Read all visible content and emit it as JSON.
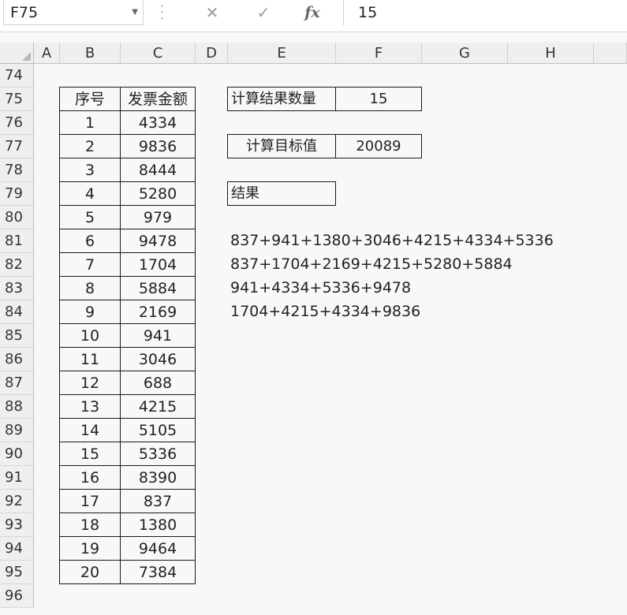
{
  "name_box": "F75",
  "formula_value": "15",
  "columns": [
    "A",
    "B",
    "C",
    "D",
    "E",
    "F",
    "G",
    "H"
  ],
  "rows": [
    "74",
    "75",
    "76",
    "77",
    "78",
    "79",
    "80",
    "81",
    "82",
    "83",
    "84",
    "85",
    "86",
    "87",
    "88",
    "89",
    "90",
    "91",
    "92",
    "93",
    "94",
    "95",
    "96"
  ],
  "table": {
    "headers": [
      "序号",
      "发票金额"
    ],
    "rows": [
      [
        "1",
        "4334"
      ],
      [
        "2",
        "9836"
      ],
      [
        "3",
        "8444"
      ],
      [
        "4",
        "5280"
      ],
      [
        "5",
        "979"
      ],
      [
        "6",
        "9478"
      ],
      [
        "7",
        "1704"
      ],
      [
        "8",
        "5884"
      ],
      [
        "9",
        "2169"
      ],
      [
        "10",
        "941"
      ],
      [
        "11",
        "3046"
      ],
      [
        "12",
        "688"
      ],
      [
        "13",
        "4215"
      ],
      [
        "14",
        "5105"
      ],
      [
        "15",
        "5336"
      ],
      [
        "16",
        "8390"
      ],
      [
        "17",
        "837"
      ],
      [
        "18",
        "1380"
      ],
      [
        "19",
        "9464"
      ],
      [
        "20",
        "7384"
      ]
    ]
  },
  "params": {
    "count_label": "计算结果数量",
    "count_value": "15",
    "target_label": "计算目标值",
    "target_value": "20089",
    "result_label": "结果"
  },
  "results": [
    "837+941+1380+3046+4215+4334+5336",
    "837+1704+2169+4215+5280+5884",
    "941+4334+5336+9478",
    "1704+4215+4334+9836"
  ]
}
